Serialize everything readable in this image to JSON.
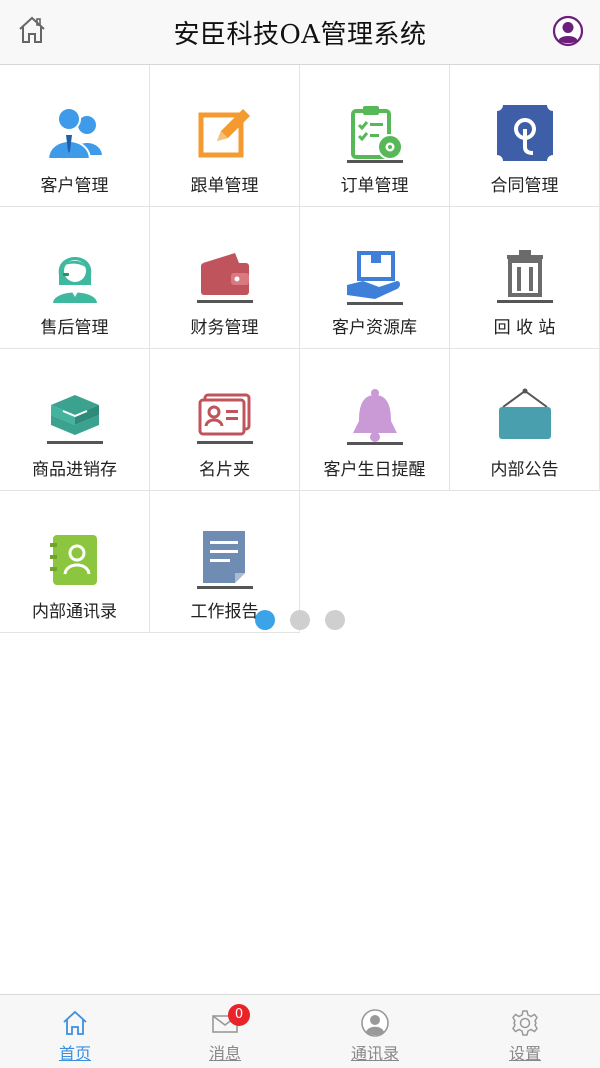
{
  "header": {
    "title": "安臣科技OA管理系统"
  },
  "icons": {
    "home": "home-icon",
    "user": "user-avatar-icon"
  },
  "modules": [
    {
      "label": "客户管理",
      "icon": "customer-icon"
    },
    {
      "label": "跟单管理",
      "icon": "edit-icon"
    },
    {
      "label": "订单管理",
      "icon": "order-clipboard-icon"
    },
    {
      "label": "合同管理",
      "icon": "contract-icon"
    },
    {
      "label": "售后管理",
      "icon": "service-agent-icon"
    },
    {
      "label": "财务管理",
      "icon": "wallet-icon"
    },
    {
      "label": "客户资源库",
      "icon": "resource-box-icon"
    },
    {
      "label": "回 收 站",
      "icon": "trash-icon"
    },
    {
      "label": "商品进销存",
      "icon": "inventory-box-icon"
    },
    {
      "label": "名片夹",
      "icon": "card-holder-icon"
    },
    {
      "label": "客户生日提醒",
      "icon": "bell-icon"
    },
    {
      "label": "内部公告",
      "icon": "notice-board-icon"
    },
    {
      "label": "内部通讯录",
      "icon": "address-book-icon"
    },
    {
      "label": "工作报告",
      "icon": "report-document-icon"
    }
  ],
  "pager": {
    "total": 3,
    "active": 0
  },
  "tabbar": {
    "tabs": [
      {
        "label": "首页",
        "icon": "home-icon",
        "active": true
      },
      {
        "label": "消息",
        "icon": "mail-icon",
        "active": false
      },
      {
        "label": "通讯录",
        "icon": "contacts-icon",
        "active": false
      },
      {
        "label": "设置",
        "icon": "gear-icon",
        "active": false
      }
    ],
    "message_badge": "0"
  },
  "colors": {
    "accent": "#3b8fe0",
    "badge": "#e9232a",
    "dot_active": "#3ba3e8",
    "dot_inactive": "#cfcfcf"
  }
}
